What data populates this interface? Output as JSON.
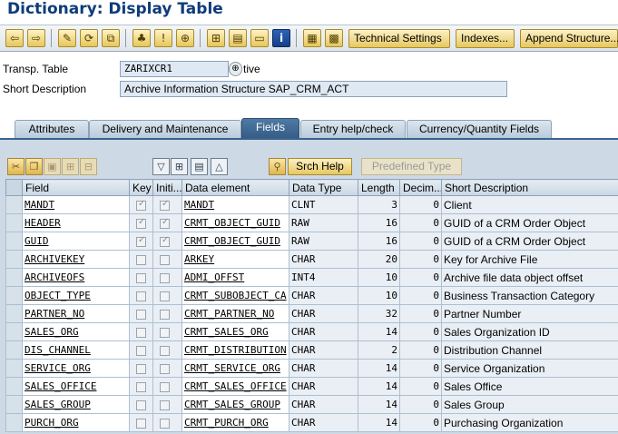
{
  "window": {
    "title": "Dictionary: Display Table"
  },
  "toolbar": {
    "icons": [
      "back-icon",
      "forward-icon",
      "edit-icon",
      "switch-icon",
      "change-icon",
      "hierarchy-icon",
      "info-icon",
      "tree-icon",
      "layout-icon",
      "print-icon",
      "window-icon",
      "information-icon",
      "grid-icon",
      "table-icon"
    ],
    "buttons": [
      "Technical Settings",
      "Indexes...",
      "Append Structure..."
    ]
  },
  "header": {
    "table_label": "Transp. Table",
    "table_name": "ZARIXCR1",
    "status": "tive",
    "desc_label": "Short Description",
    "description": "Archive Information Structure SAP_CRM_ACT"
  },
  "tabs": [
    {
      "label": "Attributes",
      "active": false
    },
    {
      "label": "Delivery and Maintenance",
      "active": false
    },
    {
      "label": "Fields",
      "active": true
    },
    {
      "label": "Entry help/check",
      "active": false
    },
    {
      "label": "Currency/Quantity Fields",
      "active": false
    }
  ],
  "fields_toolbar": {
    "srch_help": "Srch Help",
    "predefined_type": "Predefined Type"
  },
  "columns": [
    "Field",
    "Key",
    "Initi...",
    "Data element",
    "Data Type",
    "Length",
    "Decim...",
    "Short Description"
  ],
  "rows": [
    {
      "field": "MANDT",
      "key": true,
      "init": true,
      "data_element": "MANDT",
      "data_type": "CLNT",
      "length": "3",
      "decimals": "0",
      "description": "Client"
    },
    {
      "field": "HEADER",
      "key": true,
      "init": true,
      "data_element": "CRMT_OBJECT_GUID",
      "data_type": "RAW",
      "length": "16",
      "decimals": "0",
      "description": "GUID of a CRM Order Object"
    },
    {
      "field": "GUID",
      "key": true,
      "init": true,
      "data_element": "CRMT_OBJECT_GUID",
      "data_type": "RAW",
      "length": "16",
      "decimals": "0",
      "description": "GUID of a CRM Order Object"
    },
    {
      "field": "ARCHIVEKEY",
      "key": false,
      "init": false,
      "data_element": "ARKEY",
      "data_type": "CHAR",
      "length": "20",
      "decimals": "0",
      "description": "Key for Archive File"
    },
    {
      "field": "ARCHIVEOFS",
      "key": false,
      "init": false,
      "data_element": "ADMI_OFFST",
      "data_type": "INT4",
      "length": "10",
      "decimals": "0",
      "description": "Archive file data object offset"
    },
    {
      "field": "OBJECT_TYPE",
      "key": false,
      "init": false,
      "data_element": "CRMT_SUBOBJECT_CA",
      "data_type": "CHAR",
      "length": "10",
      "decimals": "0",
      "description": "Business Transaction Category"
    },
    {
      "field": "PARTNER_NO",
      "key": false,
      "init": false,
      "data_element": "CRMT_PARTNER_NO",
      "data_type": "CHAR",
      "length": "32",
      "decimals": "0",
      "description": "Partner Number"
    },
    {
      "field": "SALES_ORG",
      "key": false,
      "init": false,
      "data_element": "CRMT_SALES_ORG",
      "data_type": "CHAR",
      "length": "14",
      "decimals": "0",
      "description": "Sales Organization ID"
    },
    {
      "field": "DIS_CHANNEL",
      "key": false,
      "init": false,
      "data_element": "CRMT_DISTRIBUTION",
      "data_type": "CHAR",
      "length": "2",
      "decimals": "0",
      "description": "Distribution Channel"
    },
    {
      "field": "SERVICE_ORG",
      "key": false,
      "init": false,
      "data_element": "CRMT_SERVICE_ORG",
      "data_type": "CHAR",
      "length": "14",
      "decimals": "0",
      "description": "Service Organization"
    },
    {
      "field": "SALES_OFFICE",
      "key": false,
      "init": false,
      "data_element": "CRMT_SALES_OFFICE",
      "data_type": "CHAR",
      "length": "14",
      "decimals": "0",
      "description": "Sales Office"
    },
    {
      "field": "SALES_GROUP",
      "key": false,
      "init": false,
      "data_element": "CRMT_SALES_GROUP",
      "data_type": "CHAR",
      "length": "14",
      "decimals": "0",
      "description": "Sales Group"
    },
    {
      "field": "PURCH_ORG",
      "key": false,
      "init": false,
      "data_element": "CRMT_PURCH_ORG",
      "data_type": "CHAR",
      "length": "14",
      "decimals": "0",
      "description": "Purchasing Organization"
    }
  ]
}
